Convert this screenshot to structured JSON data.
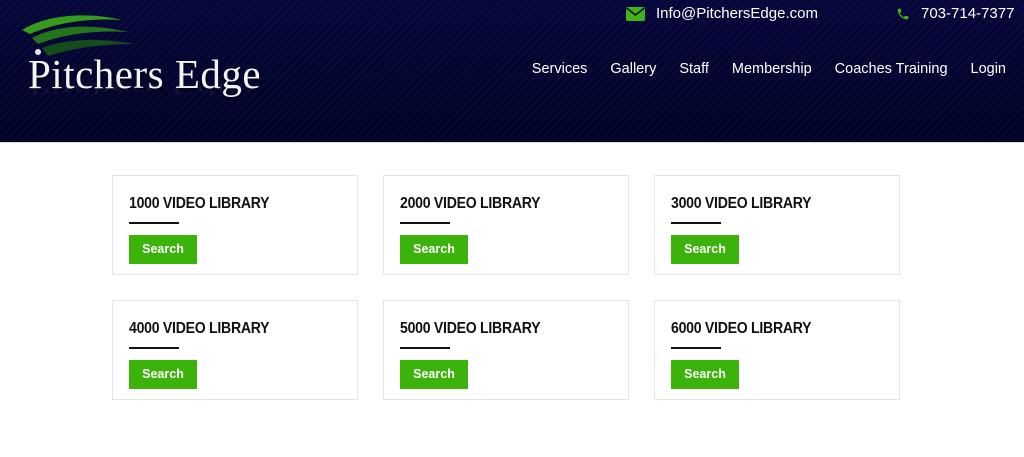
{
  "header": {
    "logo_text": "Pitchers Edge",
    "email": "Info@PitchersEdge.com",
    "phone": "703-714-7377",
    "nav": [
      "Services",
      "Gallery",
      "Staff",
      "Membership",
      "Coaches Training",
      "Login"
    ]
  },
  "colors": {
    "header_bg": "#03042e",
    "accent_green": "#3bb30b",
    "icon_green": "#3fb618"
  },
  "icons": {
    "email": "envelope-icon",
    "phone": "phone-icon"
  },
  "libraries": [
    {
      "title": "1000 VIDEO LIBRARY",
      "button": "Search"
    },
    {
      "title": "2000 VIDEO LIBRARY",
      "button": "Search"
    },
    {
      "title": "3000 VIDEO LIBRARY",
      "button": "Search"
    },
    {
      "title": "4000 VIDEO LIBRARY",
      "button": "Search"
    },
    {
      "title": "5000 VIDEO LIBRARY",
      "button": "Search"
    },
    {
      "title": "6000 VIDEO LIBRARY",
      "button": "Search"
    }
  ]
}
